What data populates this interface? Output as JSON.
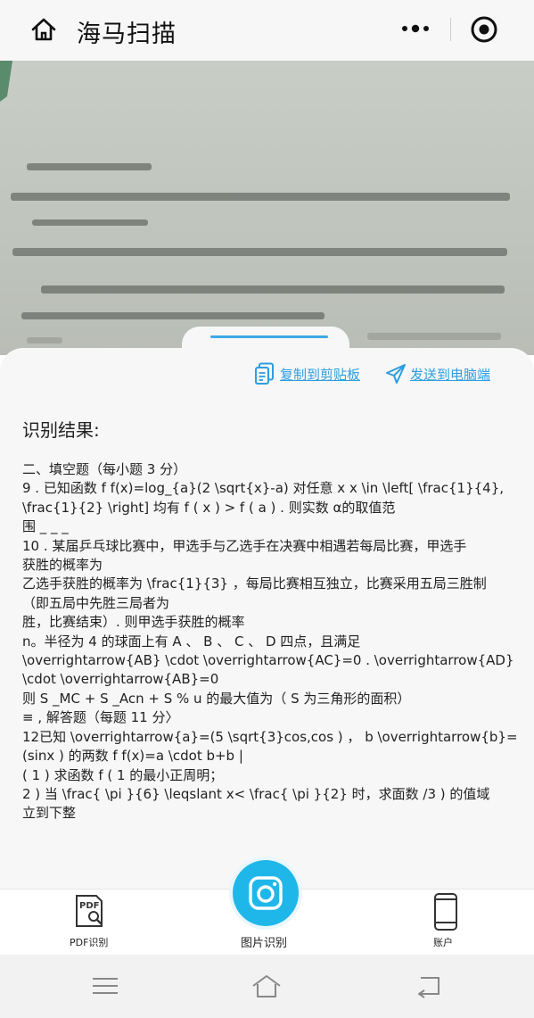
{
  "header": {
    "title": "海马扫描",
    "icons": {
      "home": "home-icon",
      "more": "more-icon",
      "target": "target-icon"
    }
  },
  "actions": {
    "copy_label": "复制到剪贴板",
    "send_label": "发送到电脑端",
    "copy_icon": "copy-icon",
    "send_icon": "send-icon"
  },
  "result": {
    "title": "识别结果:",
    "lines": [
      "二、填空题（每小题 3 分）",
      "9 . 已知函数 f f(x)=log_{a}(2 \\sqrt{x}-a) 对任意 x x \\in \\left[ \\frac{1}{4},",
      "\\frac{1}{2} \\right] 均有 f ( x ) > f ( a ) . 则实数 α的取值范",
      "围 _ _ _",
      "10 . 某届乒乓球比赛中，甲选手与乙选手在决赛中相遇若每局比赛，甲选手",
      "获胜的概率为",
      "乙选手获胜的概率为 \\frac{1}{3} ，每局比赛相互独立，比赛采用五局三胜制",
      "（即五局中先胜三局者为",
      "胜，比赛结束）. 则甲选手获胜的概率",
      "n。半径为 4 的球面上有 A 、 B 、 C 、 D 四点，且满足",
      "\\overrightarrow{AB} \\cdot \\overrightarrow{AC}=0 . \\overrightarrow{AD}",
      "\\cdot \\overrightarrow{AB}=0",
      "则 S _MC + S _Acn + S % u 的最大值为（ S 为三角形的面积）",
      "≡ , 解答题（每题 11 分〉",
      "12已知 \\overrightarrow{a}=(5 \\sqrt{3}cos,cos ) ， b \\overrightarrow{b}=",
      "(sinx ) 的两数 f f(x)=a \\cdot b+b |",
      "( 1 ) 求函数 f ( 1 的最小正周明；",
      "2 ) 当 \\frac{ \\pi }{6} \\leqslant x< \\frac{ \\pi }{2} 时，求面数 /3 ) 的值域",
      "立到下整"
    ]
  },
  "tabbar": {
    "pdf_label": "PDF识别",
    "image_label": "图片识别",
    "account_label": "账户",
    "pdf_icon": "pdf-search-icon",
    "camera_icon": "camera-icon",
    "account_icon": "phone-icon"
  },
  "system_nav": {
    "menu_icon": "menu-icon",
    "home_icon": "home-outline-icon",
    "back_icon": "back-icon"
  },
  "colors": {
    "accent": "#2d9ee0",
    "camera": "#1fb7ea",
    "header_bg": "#f7f7f7"
  }
}
